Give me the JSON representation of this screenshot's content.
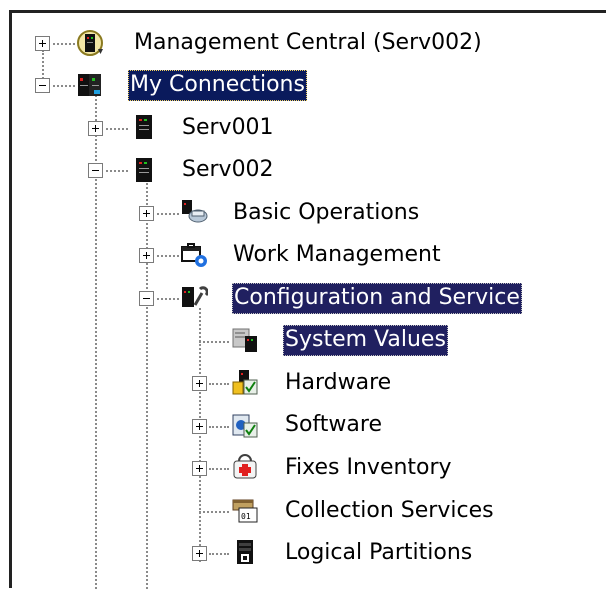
{
  "tree": {
    "items": [
      {
        "label": "Management Central (Serv002)",
        "icon": "management-central-icon",
        "expander": "plus"
      },
      {
        "label": "My Connections",
        "icon": "connections-icon",
        "expander": "minus",
        "state": "selected"
      },
      {
        "label": "Serv001",
        "icon": "server-icon",
        "expander": "plus"
      },
      {
        "label": "Serv002",
        "icon": "server-icon",
        "expander": "minus"
      },
      {
        "label": "Basic Operations",
        "icon": "basic-operations-icon",
        "expander": "plus"
      },
      {
        "label": "Work Management",
        "icon": "work-management-icon",
        "expander": "plus"
      },
      {
        "label": "Configuration and Service",
        "icon": "configuration-service-icon",
        "expander": "minus",
        "state": "selected"
      },
      {
        "label": "System Values",
        "icon": "system-values-icon",
        "expander": "none",
        "state": "selected"
      },
      {
        "label": "Hardware",
        "icon": "hardware-icon",
        "expander": "plus"
      },
      {
        "label": "Software",
        "icon": "software-icon",
        "expander": "plus"
      },
      {
        "label": "Fixes Inventory",
        "icon": "fixes-inventory-icon",
        "expander": "plus"
      },
      {
        "label": "Collection Services",
        "icon": "collection-services-icon",
        "expander": "none"
      },
      {
        "label": "Logical Partitions",
        "icon": "logical-partitions-icon",
        "expander": "plus"
      }
    ]
  },
  "colors": {
    "selection": "#0a1a5c",
    "tree_lines": "#8a8a8a"
  }
}
